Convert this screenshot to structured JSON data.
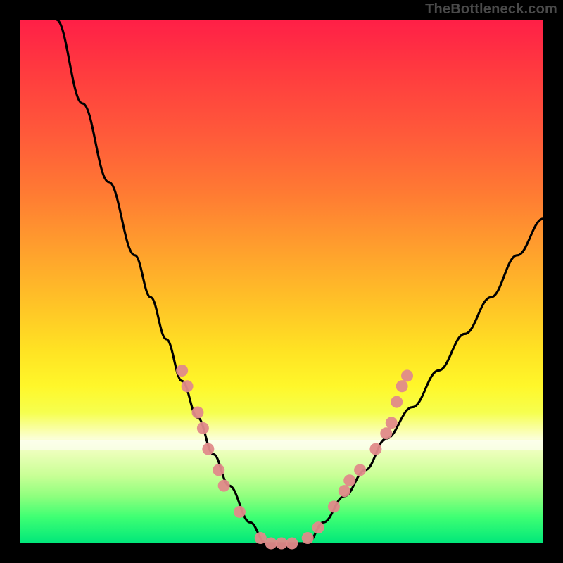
{
  "watermark": "TheBottleneck.com",
  "chart_data": {
    "type": "line",
    "title": "",
    "xlabel": "",
    "ylabel": "",
    "xlim": [
      0,
      100
    ],
    "ylim": [
      0,
      100
    ],
    "background_gradient": {
      "direction": "vertical",
      "stops": [
        {
          "pos": 0,
          "color": "#ff1f47"
        },
        {
          "pos": 10,
          "color": "#ff3b3f"
        },
        {
          "pos": 22,
          "color": "#ff5a3a"
        },
        {
          "pos": 33,
          "color": "#ff7a33"
        },
        {
          "pos": 44,
          "color": "#ffa02d"
        },
        {
          "pos": 54,
          "color": "#ffc227"
        },
        {
          "pos": 63,
          "color": "#ffe223"
        },
        {
          "pos": 70,
          "color": "#fff72a"
        },
        {
          "pos": 75,
          "color": "#f6ff4e"
        },
        {
          "pos": 80,
          "color": "#fbffd6"
        },
        {
          "pos": 83,
          "color": "#e9ffb7"
        },
        {
          "pos": 87,
          "color": "#c9ff96"
        },
        {
          "pos": 91,
          "color": "#8fff7e"
        },
        {
          "pos": 95,
          "color": "#3eff73"
        },
        {
          "pos": 100,
          "color": "#00e77a"
        }
      ]
    },
    "series": [
      {
        "name": "left_curve",
        "color": "#000000",
        "x": [
          7,
          12,
          17,
          22,
          25,
          28,
          31,
          34,
          37,
          40,
          44,
          47
        ],
        "y": [
          100,
          84,
          69,
          55,
          47,
          39,
          31,
          24,
          17,
          11,
          4,
          0
        ]
      },
      {
        "name": "right_curve",
        "color": "#000000",
        "x": [
          55,
          58,
          62,
          66,
          70,
          75,
          80,
          85,
          90,
          95,
          100
        ],
        "y": [
          0,
          4,
          9,
          14,
          20,
          26,
          33,
          40,
          47,
          55,
          62
        ]
      },
      {
        "name": "valley_floor",
        "color": "#000000",
        "x": [
          47,
          49,
          51,
          53,
          55
        ],
        "y": [
          0,
          0,
          0,
          0,
          0
        ]
      }
    ],
    "markers": [
      {
        "name": "left_cluster",
        "color": "#e08a8a",
        "points": [
          {
            "x": 31,
            "y": 33
          },
          {
            "x": 32,
            "y": 30
          },
          {
            "x": 34,
            "y": 25
          },
          {
            "x": 35,
            "y": 22
          },
          {
            "x": 36,
            "y": 18
          },
          {
            "x": 38,
            "y": 14
          },
          {
            "x": 39,
            "y": 11
          },
          {
            "x": 42,
            "y": 6
          }
        ]
      },
      {
        "name": "bottom_cluster",
        "color": "#e08a8a",
        "points": [
          {
            "x": 46,
            "y": 1
          },
          {
            "x": 48,
            "y": 0
          },
          {
            "x": 50,
            "y": 0
          },
          {
            "x": 52,
            "y": 0
          },
          {
            "x": 55,
            "y": 1
          },
          {
            "x": 57,
            "y": 3
          }
        ]
      },
      {
        "name": "right_cluster",
        "color": "#e08a8a",
        "points": [
          {
            "x": 60,
            "y": 7
          },
          {
            "x": 62,
            "y": 10
          },
          {
            "x": 63,
            "y": 12
          },
          {
            "x": 65,
            "y": 14
          },
          {
            "x": 68,
            "y": 18
          },
          {
            "x": 70,
            "y": 21
          },
          {
            "x": 71,
            "y": 23
          },
          {
            "x": 72,
            "y": 27
          },
          {
            "x": 73,
            "y": 30
          },
          {
            "x": 74,
            "y": 32
          }
        ]
      }
    ]
  }
}
